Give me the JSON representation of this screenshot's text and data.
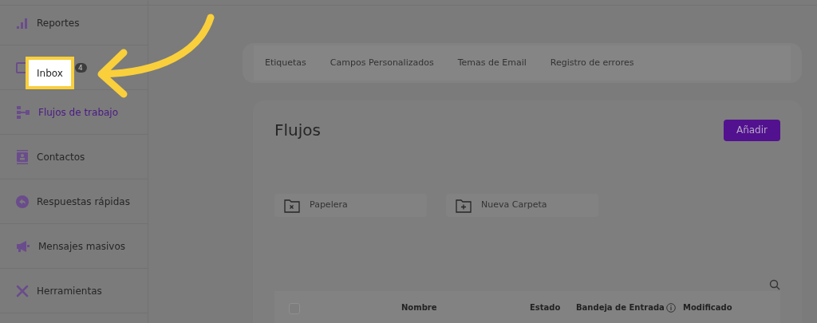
{
  "sidebar": {
    "items": [
      {
        "label": "Reportes",
        "selected": false,
        "highlighted": false
      },
      {
        "label": "Inbox",
        "selected": false,
        "highlighted": true,
        "badge": "4"
      },
      {
        "label": "Flujos de trabajo",
        "selected": true,
        "highlighted": false
      },
      {
        "label": "Contactos",
        "selected": false,
        "highlighted": false
      },
      {
        "label": "Respuestas rápidas",
        "selected": false,
        "highlighted": false
      },
      {
        "label": "Mensajes masivos",
        "selected": false,
        "highlighted": false
      },
      {
        "label": "Herramientas",
        "selected": false,
        "highlighted": false
      }
    ]
  },
  "tabs": [
    "Etiquetas",
    "Campos Personalizados",
    "Temas de Email",
    "Registro de errores"
  ],
  "panel": {
    "title": "Flujos",
    "add_button": "Añadir",
    "folders": [
      {
        "kind": "trash",
        "label": "Papelera"
      },
      {
        "kind": "new",
        "label": "Nueva Carpeta"
      }
    ],
    "table": {
      "select_all": {
        "checked": false
      },
      "columns": [
        {
          "label": "Nombre",
          "info": false
        },
        {
          "label": "Estado",
          "info": false
        },
        {
          "label": "Bandeja de Entrada",
          "info": true
        },
        {
          "label": "Modificado",
          "info": false
        }
      ]
    }
  }
}
